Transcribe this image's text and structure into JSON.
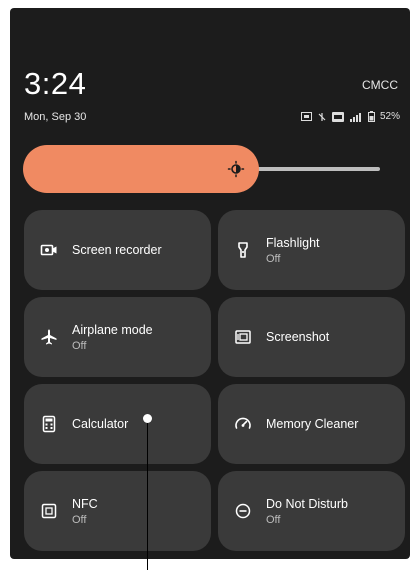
{
  "header": {
    "time": "3:24",
    "carrier": "CMCC",
    "date": "Mon, Sep 30",
    "battery": "52%"
  },
  "brightness": {
    "level_fraction": 0.66
  },
  "tiles": [
    {
      "label": "Screen recorder",
      "sub": "",
      "icon": "screen-recorder-icon"
    },
    {
      "label": "Flashlight",
      "sub": "Off",
      "icon": "flashlight-icon"
    },
    {
      "label": "Airplane mode",
      "sub": "Off",
      "icon": "airplane-icon"
    },
    {
      "label": "Screenshot",
      "sub": "",
      "icon": "screenshot-icon"
    },
    {
      "label": "Calculator",
      "sub": "",
      "icon": "calculator-icon"
    },
    {
      "label": "Memory Cleaner",
      "sub": "",
      "icon": "memory-cleaner-icon"
    },
    {
      "label": "NFC",
      "sub": "Off",
      "icon": "nfc-icon"
    },
    {
      "label": "Do Not Disturb",
      "sub": "Off",
      "icon": "do-not-disturb-icon"
    }
  ],
  "colors": {
    "accent": "#f08a62",
    "tile": "#3a3a3a",
    "panel": "#1c1c1c"
  }
}
